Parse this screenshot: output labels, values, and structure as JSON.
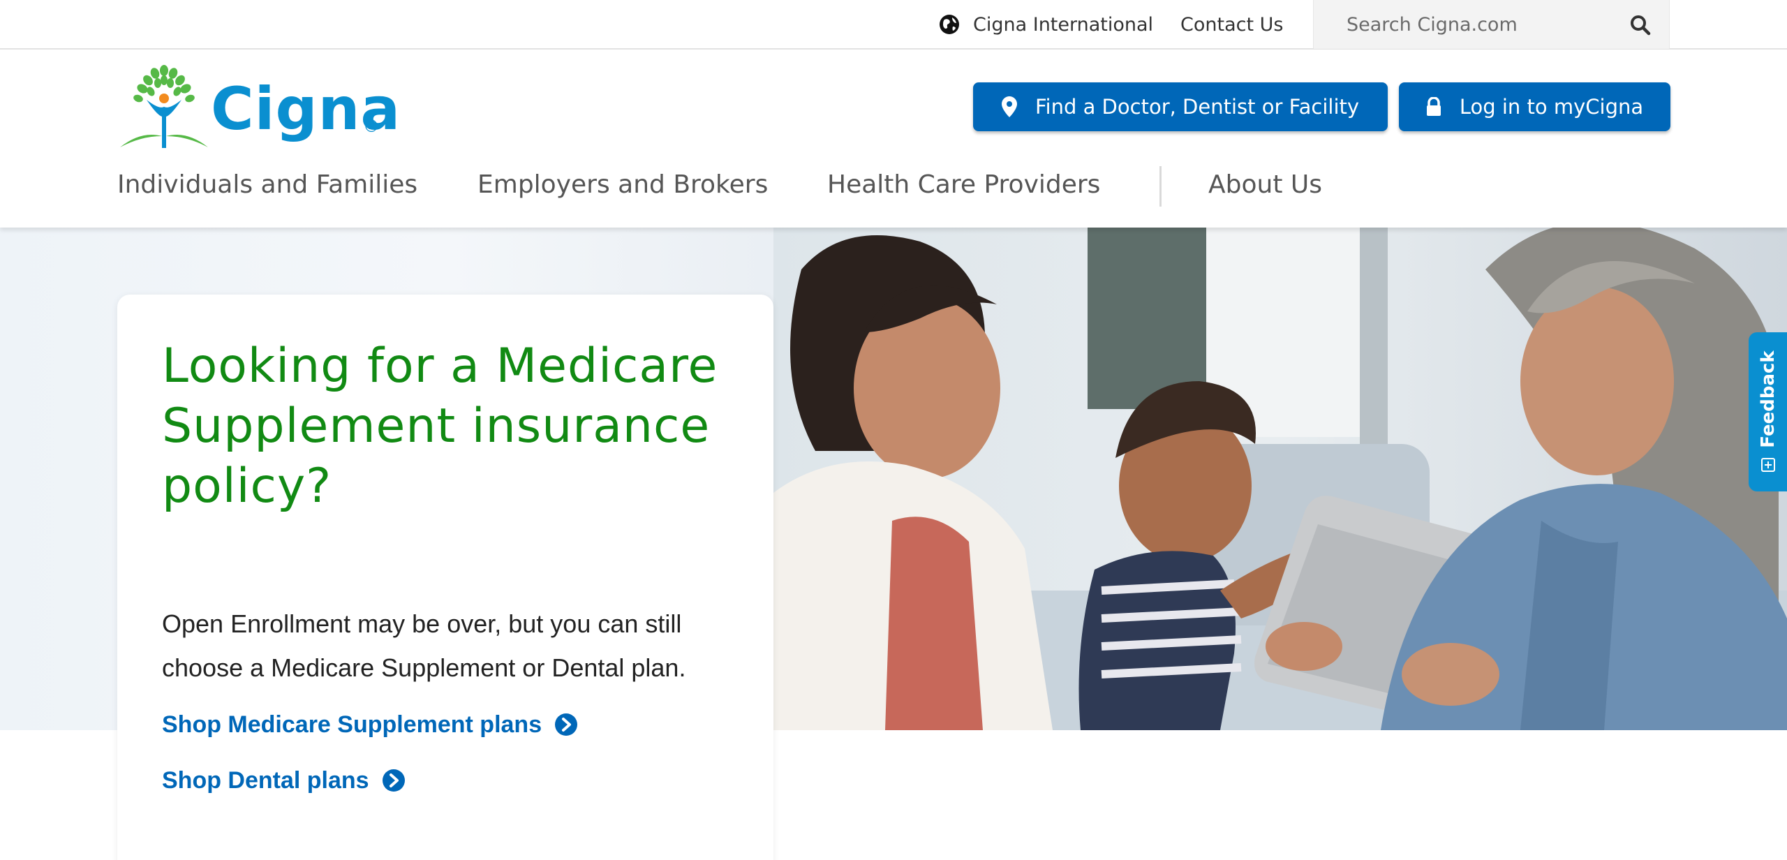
{
  "utility": {
    "international_label": "Cigna International",
    "contact_label": "Contact Us",
    "search_placeholder": "Search Cigna.com"
  },
  "header": {
    "logo_text": "Cigna",
    "logo_registered": "®",
    "find_button_label": "Find a Doctor, Dentist or Facility",
    "login_button_label": "Log in to myCigna"
  },
  "nav": {
    "items": [
      {
        "label": "Individuals and Families"
      },
      {
        "label": "Employers and Brokers"
      },
      {
        "label": "Health Care Providers"
      },
      {
        "label": "About Us"
      }
    ]
  },
  "hero": {
    "title": "Looking for a Medicare Supplement insurance policy?",
    "body": "Open Enrollment may be over, but you can still choose a Medicare Supplement or Dental plan.",
    "links": [
      {
        "label": "Shop Medicare Supplement plans"
      },
      {
        "label": "Shop Dental plans"
      }
    ]
  },
  "feedback": {
    "label": "Feedback"
  },
  "colors": {
    "brand_blue": "#0067b8",
    "logo_blue": "#0a8fd0",
    "heading_green": "#118a13",
    "feedback_blue": "#0a8fd0"
  },
  "icons": {
    "globe": "globe-icon",
    "search": "search-icon",
    "location": "map-pin-icon",
    "lock": "lock-icon",
    "chevron": "chevron-right-circle-icon"
  }
}
